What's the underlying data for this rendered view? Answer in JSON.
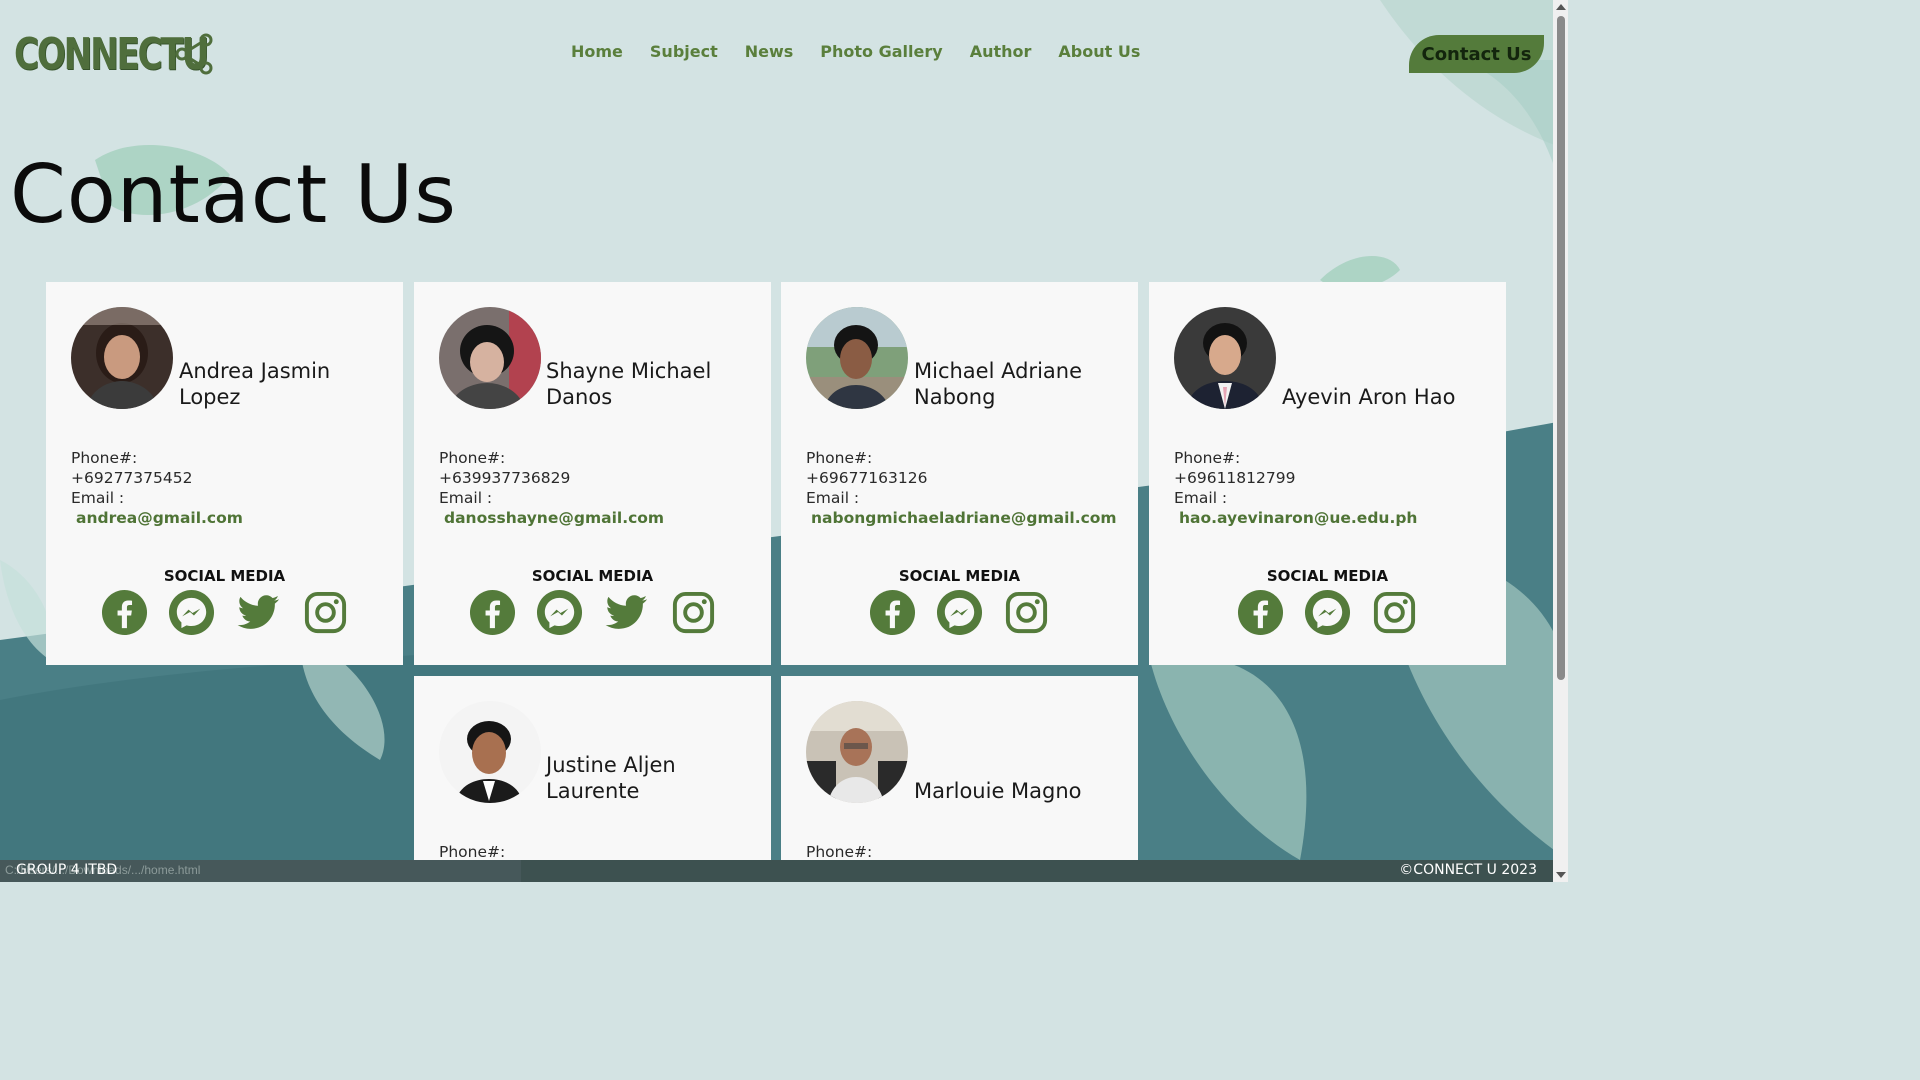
{
  "header": {
    "logo_text": "CONNECTU",
    "nav": [
      "Home",
      "Subject",
      "News",
      "Photo Gallery",
      "Author",
      "About Us"
    ],
    "contact_button": "Contact Us"
  },
  "page": {
    "title": "Contact Us"
  },
  "labels": {
    "phone": "Phone#:",
    "email": "Email :",
    "social": "SOCIAL MEDIA"
  },
  "members": [
    {
      "name": "Andrea Jasmin Lopez",
      "phone": "+69277375452",
      "email": "andrea@gmail.com",
      "social": [
        "facebook-icon",
        "messenger-icon",
        "twitter-icon",
        "instagram-icon"
      ]
    },
    {
      "name": "Shayne Michael Danos",
      "phone": "+639937736829",
      "email": "danosshayne@gmail.com",
      "social": [
        "facebook-icon",
        "messenger-icon",
        "twitter-icon",
        "instagram-icon"
      ]
    },
    {
      "name": "Michael Adriane Nabong",
      "phone": "+69677163126",
      "email": "nabongmichaeladriane@gmail.com",
      "social": [
        "facebook-icon",
        "messenger-icon",
        "instagram-icon"
      ]
    },
    {
      "name": "Ayevin Aron Hao",
      "phone": "+69611812799",
      "email": "hao.ayevinaron@ue.edu.ph",
      "social": [
        "facebook-icon",
        "messenger-icon",
        "instagram-icon"
      ]
    },
    {
      "name": "Justine Aljen Laurente"
    },
    {
      "name": "Marlouie Magno"
    }
  ],
  "footer": {
    "left": "GROUP 4 ITBD",
    "right": "©CONNECT U 2023"
  },
  "status_bar": {
    "url": "C:/Users/.../Downloads/.../home.html"
  },
  "colors": {
    "accent": "#547b3b",
    "link": "#5a7f3c",
    "background": "#d3e3e3",
    "card": "#f8f8f8"
  }
}
